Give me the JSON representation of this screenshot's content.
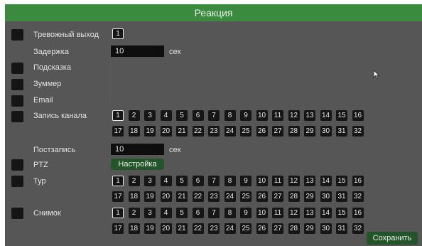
{
  "window": {
    "title": "Реакция"
  },
  "rows": {
    "alarm_out": {
      "label": "Тревожный выход",
      "value": "1"
    },
    "delay": {
      "label": "Задержка",
      "value": "10",
      "unit": "сек"
    },
    "hint": {
      "label": "Подсказка"
    },
    "buzzer": {
      "label": "Зуммер"
    },
    "email": {
      "label": "Email"
    },
    "record": {
      "label": "Запись канала"
    },
    "post_record": {
      "label": "Постзапись",
      "value": "10",
      "unit": "сек"
    },
    "ptz": {
      "label": "PTZ",
      "button": "Настройка"
    },
    "tour": {
      "label": "Тур"
    },
    "snapshot": {
      "label": "Снимок"
    }
  },
  "channels": [
    "1",
    "2",
    "3",
    "4",
    "5",
    "6",
    "7",
    "8",
    "9",
    "10",
    "11",
    "12",
    "13",
    "14",
    "15",
    "16",
    "17",
    "18",
    "19",
    "20",
    "21",
    "22",
    "23",
    "24",
    "25",
    "26",
    "27",
    "28",
    "29",
    "30",
    "31",
    "32"
  ],
  "selected_channel": "1",
  "save_button": "Сохранить",
  "colors": {
    "title_bar": "#3b8b3e",
    "panel": "#565656",
    "button": "#23542a"
  }
}
